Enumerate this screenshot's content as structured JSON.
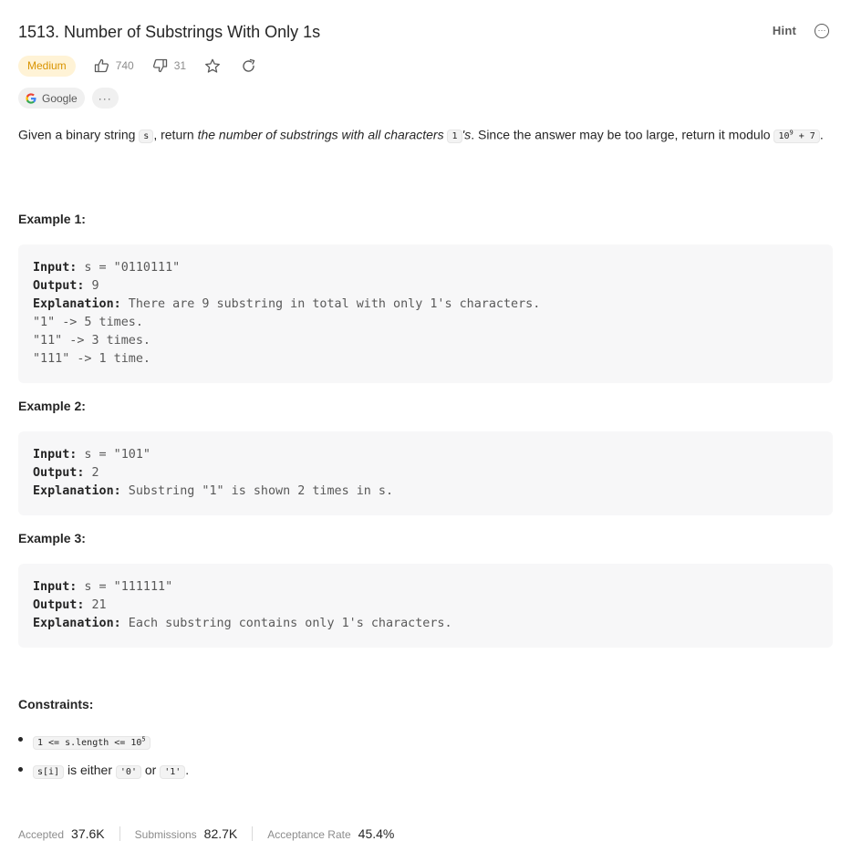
{
  "header": {
    "title": "1513. Number of Substrings With Only 1s",
    "hint_label": "Hint"
  },
  "meta": {
    "difficulty": "Medium",
    "likes": "740",
    "dislikes": "31"
  },
  "companies": {
    "tag": "Google",
    "more": "···"
  },
  "description": {
    "p1": "Given a binary string ",
    "code_s": "s",
    "p2": ", return ",
    "italic": "the number of substrings with all characters ",
    "code_1": "1",
    "italic2": "'s",
    "p3": ". Since the answer may be too large, return it modulo ",
    "mod_base": "10",
    "mod_exp": "9",
    "mod_tail": " + 7",
    "end": "."
  },
  "examples": [
    {
      "title": "Example 1:",
      "input_label": "Input:",
      "input_value": " s = \"0110111\"",
      "output_label": "Output:",
      "output_value": " 9",
      "explanation_label": "Explanation:",
      "explanation_value": " There are 9 substring in total with only 1's characters.",
      "extra": [
        "\"1\" -> 5 times.",
        "\"11\" -> 3 times.",
        "\"111\" -> 1 time."
      ]
    },
    {
      "title": "Example 2:",
      "input_label": "Input:",
      "input_value": " s = \"101\"",
      "output_label": "Output:",
      "output_value": " 2",
      "explanation_label": "Explanation:",
      "explanation_value": " Substring \"1\" is shown 2 times in s.",
      "extra": []
    },
    {
      "title": "Example 3:",
      "input_label": "Input:",
      "input_value": " s = \"111111\"",
      "output_label": "Output:",
      "output_value": " 21",
      "explanation_label": "Explanation:",
      "explanation_value": " Each substring contains only 1's characters.",
      "extra": []
    }
  ],
  "constraints": {
    "title": "Constraints:",
    "c1_code": "1 <= s.length <= 10",
    "c1_exp": "5",
    "c2_code": "s[i]",
    "c2_text1": " is either ",
    "c2_code2": "'0'",
    "c2_text2": " or ",
    "c2_code3": "'1'",
    "c2_end": "."
  },
  "stats": {
    "accepted_label": "Accepted",
    "accepted_value": "37.6K",
    "submissions_label": "Submissions",
    "submissions_value": "82.7K",
    "acceptance_label": "Acceptance Rate",
    "acceptance_value": "45.4%"
  },
  "colors": {
    "medium_text": "#d99300",
    "medium_bg": "#fff3d6",
    "code_bg": "#f7f7f8"
  }
}
